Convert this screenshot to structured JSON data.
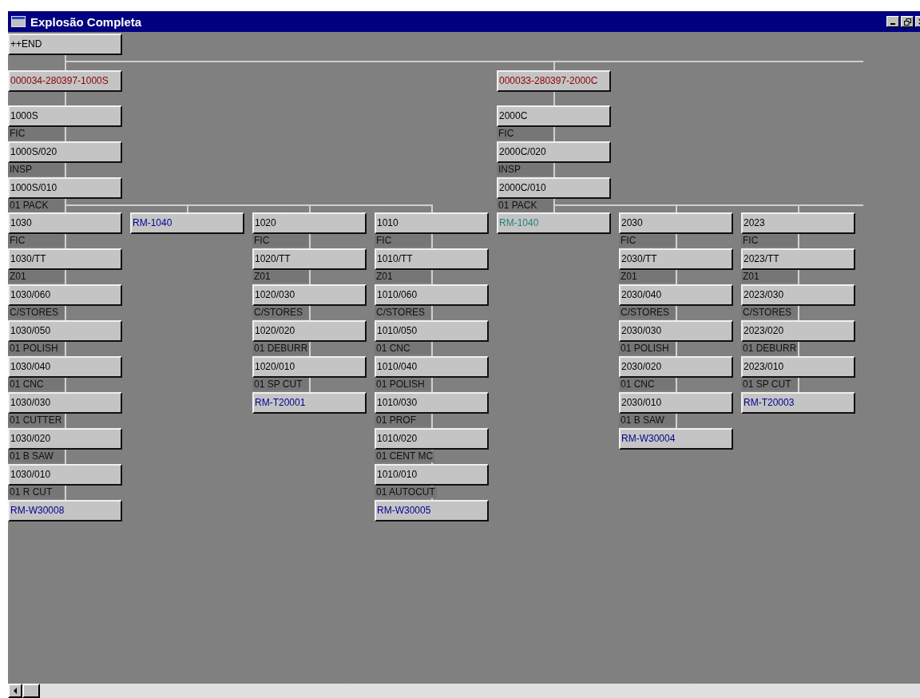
{
  "window": {
    "title": "Explosão Completa"
  },
  "root": {
    "label": "++END",
    "kind": "item"
  },
  "orders": [
    {
      "label": "000034-280397-1000S",
      "kind": "order",
      "steps": [
        {
          "label": "1000S",
          "kind": "item",
          "op": "FIC"
        },
        {
          "label": "1000S/020",
          "kind": "item",
          "op": "INSP"
        },
        {
          "label": "1000S/010",
          "kind": "item",
          "op": "01 PACK"
        }
      ],
      "components": [
        {
          "steps": [
            {
              "label": "1030",
              "kind": "item",
              "op": "FIC"
            },
            {
              "label": "1030/TT",
              "kind": "item",
              "op": "Z01"
            },
            {
              "label": "1030/060",
              "kind": "item",
              "op": "C/STORES"
            },
            {
              "label": "1030/050",
              "kind": "item",
              "op": "01 POLISH"
            },
            {
              "label": "1030/040",
              "kind": "item",
              "op": "01 CNC"
            },
            {
              "label": "1030/030",
              "kind": "item",
              "op": "01 CUTTER"
            },
            {
              "label": "1030/020",
              "kind": "item",
              "op": "01 B SAW"
            },
            {
              "label": "1030/010",
              "kind": "item",
              "op": "01 R CUT"
            },
            {
              "label": "RM-W30008",
              "kind": "raw"
            }
          ]
        },
        {
          "steps": [
            {
              "label": "RM-1040",
              "kind": "raw"
            }
          ]
        },
        {
          "steps": [
            {
              "label": "1020",
              "kind": "item",
              "op": "FIC"
            },
            {
              "label": "1020/TT",
              "kind": "item",
              "op": "Z01"
            },
            {
              "label": "1020/030",
              "kind": "item",
              "op": "C/STORES"
            },
            {
              "label": "1020/020",
              "kind": "item",
              "op": "01 DEBURR"
            },
            {
              "label": "1020/010",
              "kind": "item",
              "op": "01 SP CUT"
            },
            {
              "label": "RM-T20001",
              "kind": "raw"
            }
          ]
        },
        {
          "steps": [
            {
              "label": "1010",
              "kind": "item",
              "op": "FIC"
            },
            {
              "label": "1010/TT",
              "kind": "item",
              "op": "Z01"
            },
            {
              "label": "1010/060",
              "kind": "item",
              "op": "C/STORES"
            },
            {
              "label": "1010/050",
              "kind": "item",
              "op": "01 CNC"
            },
            {
              "label": "1010/040",
              "kind": "item",
              "op": "01 POLISH"
            },
            {
              "label": "1010/030",
              "kind": "item",
              "op": "01 PROF"
            },
            {
              "label": "1010/020",
              "kind": "item",
              "op": "01 CENT MC"
            },
            {
              "label": "1010/010",
              "kind": "item",
              "op": "01 AUTOCUT"
            },
            {
              "label": "RM-W30005",
              "kind": "raw"
            }
          ]
        }
      ]
    },
    {
      "label": "000033-280397-2000C",
      "kind": "order",
      "steps": [
        {
          "label": "2000C",
          "kind": "item",
          "op": "FIC"
        },
        {
          "label": "2000C/020",
          "kind": "item",
          "op": "INSP"
        },
        {
          "label": "2000C/010",
          "kind": "item",
          "op": "01 PACK"
        }
      ],
      "components": [
        {
          "steps": [
            {
              "label": "RM-1040",
              "kind": "raw-shared"
            }
          ]
        },
        {
          "steps": [
            {
              "label": "2030",
              "kind": "item",
              "op": "FIC"
            },
            {
              "label": "2030/TT",
              "kind": "item",
              "op": "Z01"
            },
            {
              "label": "2030/040",
              "kind": "item",
              "op": "C/STORES"
            },
            {
              "label": "2030/030",
              "kind": "item",
              "op": "01 POLISH"
            },
            {
              "label": "2030/020",
              "kind": "item",
              "op": "01 CNC"
            },
            {
              "label": "2030/010",
              "kind": "item",
              "op": "01 B SAW"
            },
            {
              "label": "RM-W30004",
              "kind": "raw"
            }
          ]
        },
        {
          "steps": [
            {
              "label": "2023",
              "kind": "item",
              "op": "FIC"
            },
            {
              "label": "2023/TT",
              "kind": "item",
              "op": "Z01"
            },
            {
              "label": "2023/030",
              "kind": "item",
              "op": "C/STORES"
            },
            {
              "label": "2023/020",
              "kind": "item",
              "op": "01 DEBURR"
            },
            {
              "label": "2023/010",
              "kind": "item",
              "op": "01 SP CUT"
            },
            {
              "label": "RM-T20003",
              "kind": "raw"
            }
          ]
        }
      ]
    }
  ]
}
